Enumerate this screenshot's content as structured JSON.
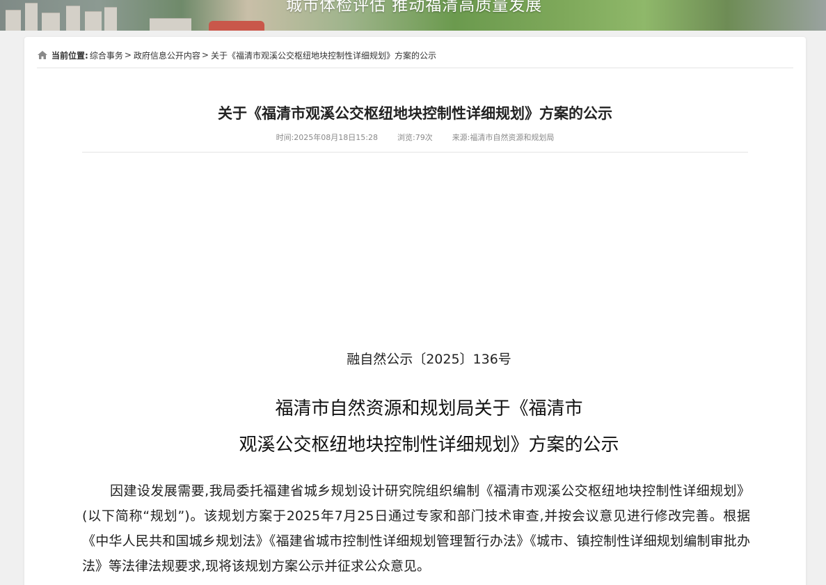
{
  "banner": {
    "slogan": "城市体检评估 推动福清高质量发展"
  },
  "breadcrumb": {
    "label": "当前位置:",
    "items": [
      "综合事务",
      "政府信息公开内容",
      "关于《福清市观溪公交枢纽地块控制性详细规划》方案的公示"
    ],
    "separator": ">"
  },
  "article": {
    "title": "关于《福清市观溪公交枢纽地块控制性详细规划》方案的公示",
    "meta": {
      "time": "时间:2025年08月18日15:28",
      "views": "浏览:79次",
      "source": "来源:福清市自然资源和规划局"
    },
    "doc_number": "融自然公示〔2025〕136号",
    "doc_title_line1": "福清市自然资源和规划局关于《福清市",
    "doc_title_line2": "观溪公交枢纽地块控制性详细规划》方案的公示",
    "paragraph": "因建设发展需要,我局委托福建省城乡规划设计研究院组织编制《福清市观溪公交枢纽地块控制性详细规划》(以下简称“规划”)。该规划方案于2025年7月25日通过专家和部门技术审查,并按会议意见进行修改完善。根据《中华人民共和国城乡规划法》《福建省城市控制性详细规划管理暂行办法》《城市、镇控制性详细规划编制审批办法》等法律法规要求,现将该规划方案公示并征求公众意见。"
  },
  "icons": {
    "home": "home-icon"
  }
}
